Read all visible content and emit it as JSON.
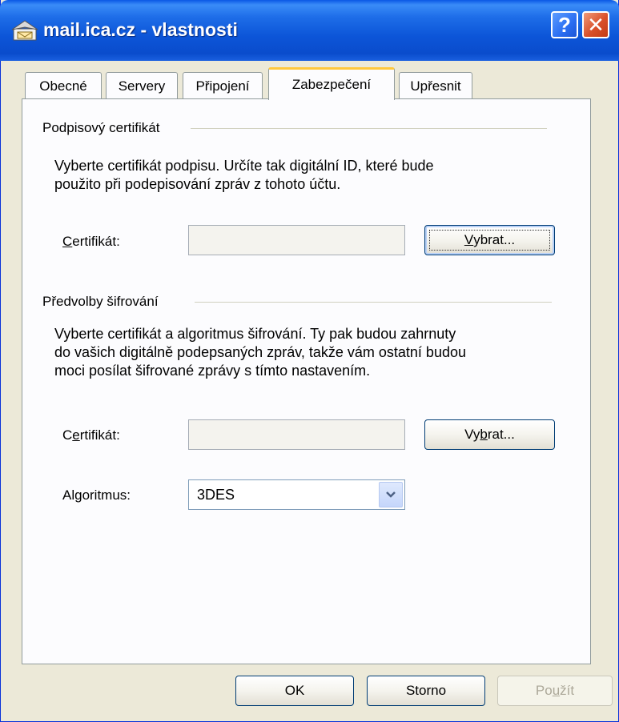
{
  "window": {
    "title": "mail.ica.cz - vlastnosti"
  },
  "titlebar_buttons": {
    "help": "?",
    "close": "✕"
  },
  "tabs": [
    {
      "label": "Obecné"
    },
    {
      "label": "Servery"
    },
    {
      "label": "Připojení"
    },
    {
      "label": "Zabezpečení",
      "active": true
    },
    {
      "label": "Upřesnit"
    }
  ],
  "signing": {
    "group_label": "Podpisový certifikát",
    "description_line1": "Vyberte certifikát podpisu. Určíte tak digitální ID, které bude",
    "description_line2": "použito při podepisování zpráv z tohoto účtu.",
    "cert_label_u": "C",
    "cert_label_rest": "ertifikát:",
    "cert_value": "",
    "select_btn_u": "V",
    "select_btn_rest": "ybrat..."
  },
  "encryption": {
    "group_label": "Předvolby šifrování",
    "description_line1": "Vyberte certifikát a algoritmus šifrování. Ty pak budou zahrnuty",
    "description_line2": "do vašich digitálně podepsaných zpráv, takže vám ostatní budou",
    "description_line3": "moci posílat šifrované zprávy s tímto nastavením.",
    "cert_label_a": "C",
    "cert_label_u": "e",
    "cert_label_rest": "rtifikát:",
    "cert_value": "",
    "select_btn_a": "Vy",
    "select_btn_u": "b",
    "select_btn_rest": "rat...",
    "algorithm_label": "Algoritmus:",
    "algorithm_value": "3DES"
  },
  "footer": {
    "ok": "OK",
    "cancel": "Storno",
    "apply_a": "Po",
    "apply_u": "u",
    "apply_rest": "žít"
  },
  "colors": {
    "titlebar": "#0a4ccc",
    "dialog_bg": "#ece9d8",
    "panel_bg": "#fcfcfe",
    "active_tab_accent": "#ffc83c"
  }
}
